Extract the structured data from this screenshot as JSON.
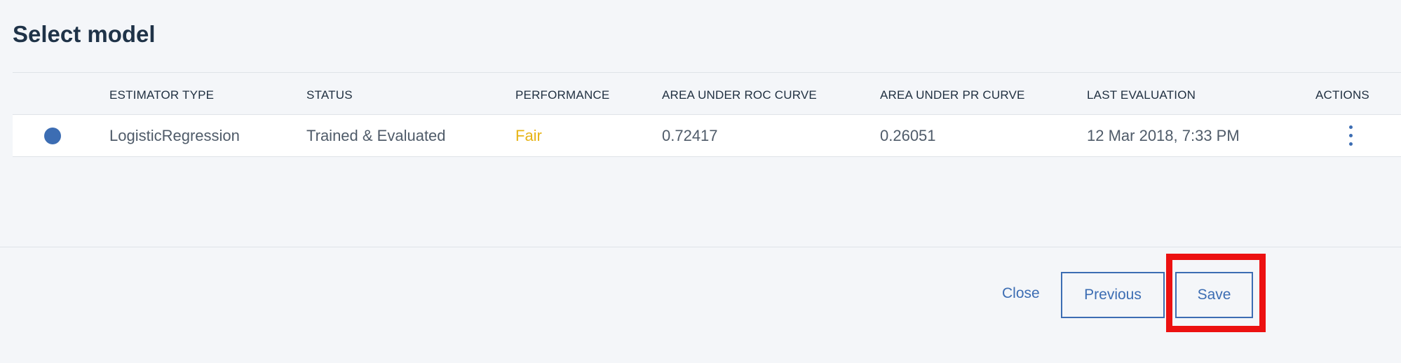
{
  "page": {
    "title": "Select model"
  },
  "table": {
    "columns": [
      "ESTIMATOR TYPE",
      "STATUS",
      "PERFORMANCE",
      "AREA UNDER ROC CURVE",
      "AREA UNDER PR CURVE",
      "LAST EVALUATION",
      "ACTIONS"
    ],
    "rows": [
      {
        "estimator_type": "LogisticRegression",
        "status": "Trained & Evaluated",
        "performance": "Fair",
        "area_under_roc_curve": "0.72417",
        "area_under_pr_curve": "0.26051",
        "last_evaluation": "12 Mar 2018, 7:33 PM",
        "selected": true
      }
    ]
  },
  "footer": {
    "close_label": "Close",
    "previous_label": "Previous",
    "save_label": "Save"
  },
  "colors": {
    "accent": "#3c6db3",
    "fair": "#e7b416",
    "highlight": "#ec1111",
    "background": "#f4f6f9"
  },
  "icons": {
    "row_select": "radio-selected-icon",
    "row_actions": "overflow-menu-icon"
  }
}
